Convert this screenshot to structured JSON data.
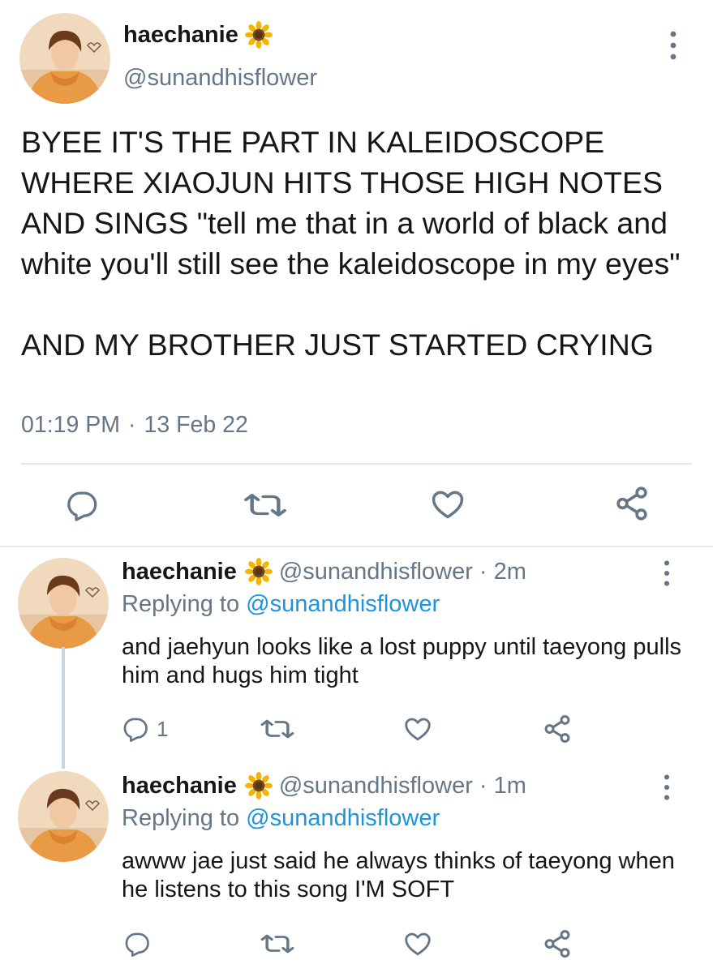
{
  "main_tweet": {
    "name": "haechanie",
    "name_emoji": "sunflower-icon",
    "handle": "@sunandhisflower",
    "text_paragraphs": [
      "BYEE IT'S THE PART IN KALEIDOSCOPE WHERE XIAOJUN HITS THOSE HIGH NOTES AND SINGS \"tell me that in a world of black and white you'll still see the kaleidoscope in my eyes\"",
      "AND MY BROTHER JUST STARTED CRYING"
    ],
    "time": "01:19 PM",
    "separator": "·",
    "date": "13 Feb 22"
  },
  "replies": [
    {
      "name": "haechanie",
      "handle": "@sunandhisflower",
      "age": "· 2m",
      "replying_prefix": "Replying to",
      "replying_to": "@sunandhisflower",
      "text": "and jaehyun looks like a lost puppy until taeyong pulls him and hugs him tight",
      "reply_count": "1"
    },
    {
      "name": "haechanie",
      "handle": "@sunandhisflower",
      "age": "· 1m",
      "replying_prefix": "Replying to",
      "replying_to": "@sunandhisflower",
      "text": "awww jae just said he always thinks of taeyong when he listens to this song I'M SOFT",
      "reply_count": ""
    }
  ],
  "colors": {
    "text": "#14171a",
    "muted": "#657786",
    "link": "#1b95e0",
    "icon": "#657786",
    "divider": "#e1e8ed"
  }
}
